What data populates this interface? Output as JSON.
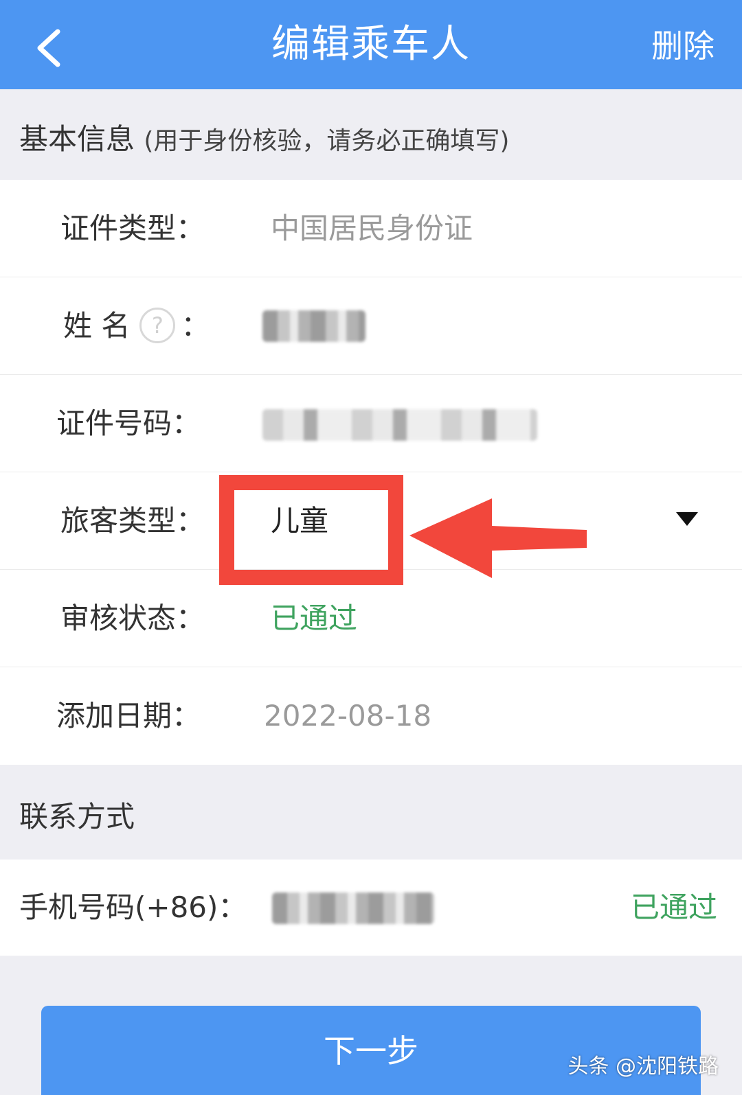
{
  "header": {
    "title": "编辑乘车人",
    "delete_label": "删除",
    "back_icon": "chevron-left-icon"
  },
  "basic_section": {
    "title": "基本信息",
    "subtitle": "(用于身份核验，请务必正确填写)"
  },
  "fields": {
    "id_type": {
      "label": "证件类型：",
      "value": "中国居民身份证"
    },
    "name": {
      "label": "姓 名",
      "label_suffix": "：",
      "help_icon": "question-circle-icon",
      "help_glyph": "?"
    },
    "id_number": {
      "label": "证件号码："
    },
    "passenger_type": {
      "label": "旅客类型：",
      "value": "儿童",
      "dropdown_icon": "triangle-down-icon"
    },
    "review_status": {
      "label": "审核状态：",
      "value": "已通过"
    },
    "add_date": {
      "label": "添加日期：",
      "value": "2022-08-18"
    }
  },
  "contact_section": {
    "title": "联系方式"
  },
  "phone": {
    "label": "手机号码(+86)：",
    "status": "已通过"
  },
  "next_button": {
    "label": "下一步"
  },
  "watermark": "头条 @沈阳铁路",
  "colors": {
    "primary_blue": "#4d96f2",
    "status_green": "#3fa35f",
    "highlight_red": "#f2473c",
    "background": "#eeeef3"
  }
}
